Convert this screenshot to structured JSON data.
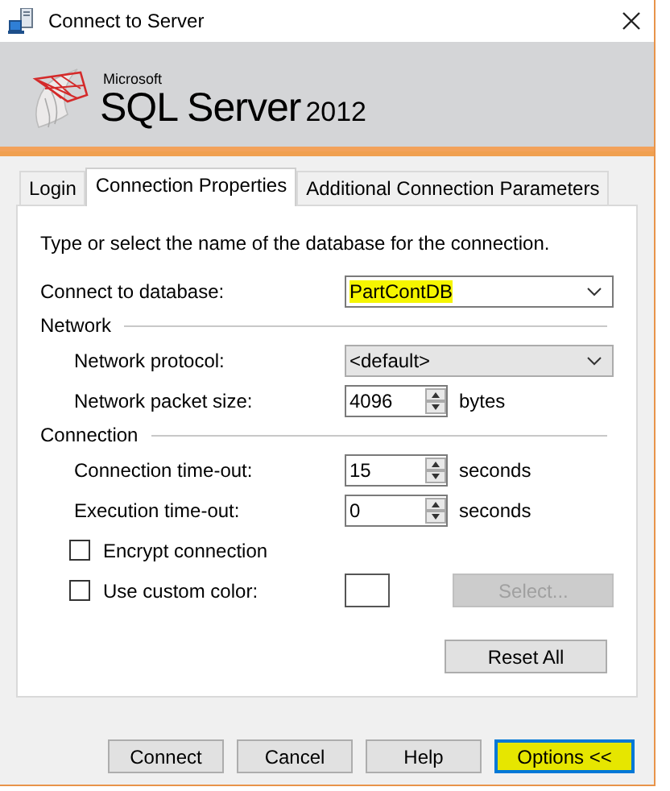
{
  "window": {
    "title": "Connect to Server"
  },
  "banner": {
    "vendor": "Microsoft",
    "product": "SQL Server",
    "version": "2012"
  },
  "tabs": [
    {
      "label": "Login",
      "selected": false
    },
    {
      "label": "Connection Properties",
      "selected": true
    },
    {
      "label": "Additional Connection Parameters",
      "selected": false
    }
  ],
  "description": "Type or select the name of the database for the connection.",
  "database": {
    "label": "Connect to database:",
    "value": "PartContDB",
    "editable": true,
    "highlighted": true
  },
  "sections": [
    {
      "title": "Network",
      "fields": [
        {
          "kind": "combo",
          "label": "Network protocol:",
          "value": "<default>",
          "editable": false
        },
        {
          "kind": "spin",
          "label": "Network packet size:",
          "value": "4096",
          "unit": "bytes"
        }
      ]
    },
    {
      "title": "Connection",
      "fields": [
        {
          "kind": "spin",
          "label": "Connection time-out:",
          "value": "15",
          "unit": "seconds"
        },
        {
          "kind": "spin",
          "label": "Execution time-out:",
          "value": "0",
          "unit": "seconds"
        }
      ]
    }
  ],
  "checkboxes": [
    {
      "label": "Encrypt connection",
      "checked": false
    },
    {
      "label": "Use custom color:",
      "checked": false
    }
  ],
  "color_select": {
    "label": "Select...",
    "disabled": true
  },
  "reset_button": {
    "label": "Reset All"
  },
  "buttons": [
    {
      "label": "Connect",
      "highlighted": false,
      "focused": false
    },
    {
      "label": "Cancel",
      "highlighted": false,
      "focused": false
    },
    {
      "label": "Help",
      "highlighted": false,
      "focused": false
    },
    {
      "label": "Options <<",
      "highlighted": true,
      "focused": true
    }
  ]
}
